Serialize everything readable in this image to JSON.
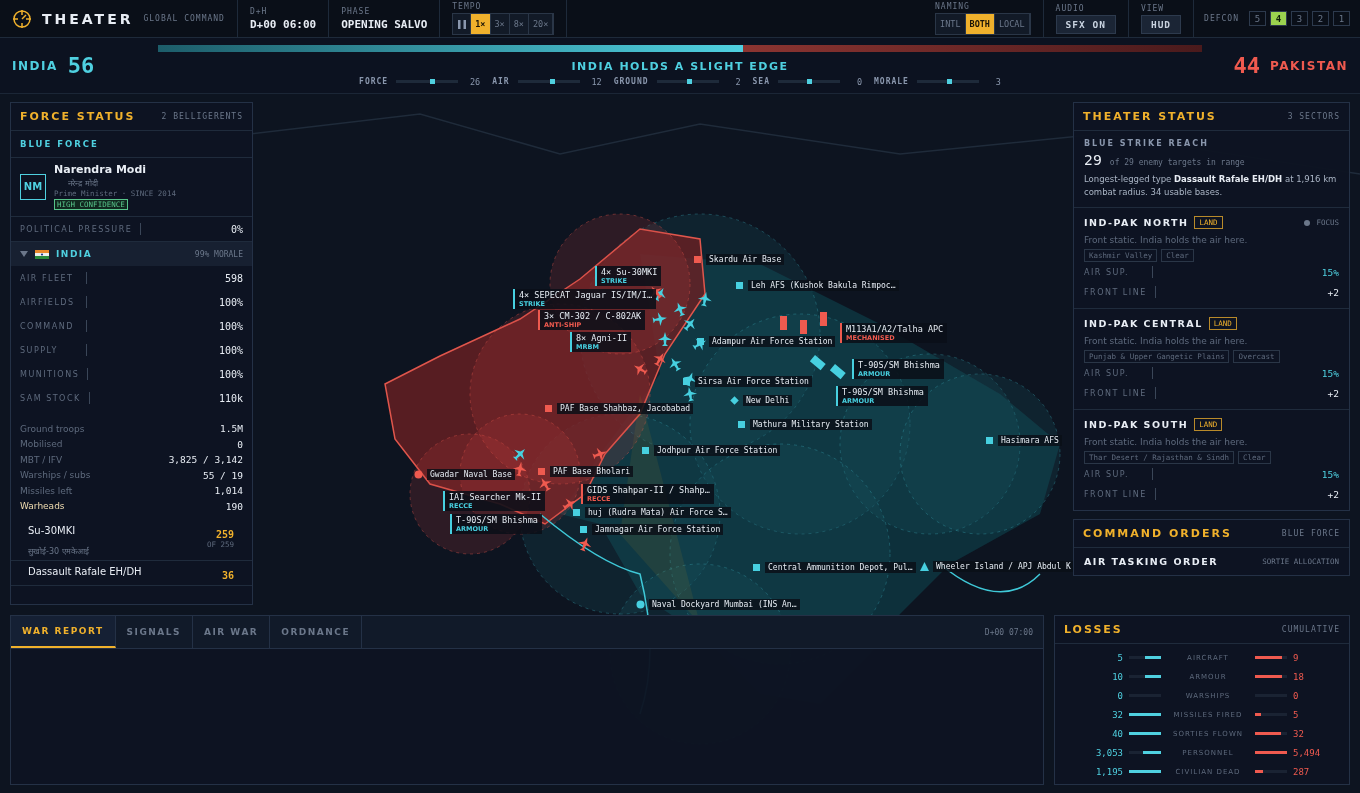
{
  "header": {
    "title": "THEATER",
    "subtitle": "GLOBAL COMMAND",
    "clock": {
      "label": "D+H",
      "value": "D+00 06:00"
    },
    "phase": {
      "label": "PHASE",
      "value": "OPENING SALVO"
    },
    "tempo": {
      "label": "TEMPO",
      "paused": false,
      "speeds": [
        {
          "label": "1×",
          "selected": true
        },
        {
          "label": "3×",
          "selected": false
        },
        {
          "label": "8×",
          "selected": false
        },
        {
          "label": "20×",
          "selected": false
        }
      ]
    },
    "naming": {
      "label": "NAMING",
      "options": [
        {
          "label": "INTL",
          "selected": false
        },
        {
          "label": "BOTH",
          "selected": true
        },
        {
          "label": "LOCAL",
          "selected": false
        }
      ]
    },
    "audio": {
      "label": "AUDIO",
      "button": "SFX ON"
    },
    "view": {
      "label": "VIEW",
      "button": "HUD"
    },
    "defcon": {
      "label": "DEFCON",
      "levels": [
        {
          "label": "5",
          "selected": false
        },
        {
          "label": "4",
          "selected": true
        },
        {
          "label": "3",
          "selected": false
        },
        {
          "label": "2",
          "selected": false
        },
        {
          "label": "1",
          "selected": false
        }
      ]
    }
  },
  "scoreboard": {
    "blue": {
      "name": "INDIA",
      "score": "56"
    },
    "red": {
      "name": "PAKISTAN",
      "score": "44"
    },
    "balance": {
      "level": 0.56
    },
    "headline": "INDIA HOLDS A SLIGHT EDGE",
    "metrics": [
      {
        "label": "FORCE",
        "level": 0.58,
        "value": "26"
      },
      {
        "label": "AIR",
        "level": 0.56,
        "value": "12"
      },
      {
        "label": "GROUND",
        "level": 0.52,
        "value": "2"
      },
      {
        "label": "SEA",
        "level": 0.5,
        "value": "0"
      },
      {
        "label": "MORALE",
        "level": 0.52,
        "value": "3"
      }
    ]
  },
  "map": {
    "places": [
      {
        "name": "Skardu Air Base",
        "color": "#ef5a4f",
        "kind": "base"
      },
      {
        "name": "Leh AFS (Kushok Bakula Rimpoc…",
        "color": "#47d0e0",
        "kind": "base"
      },
      {
        "name": "Adampur Air Force Station",
        "color": "#47d0e0",
        "kind": "base"
      },
      {
        "name": "Sirsa Air Force Station",
        "color": "#47d0e0",
        "kind": "base"
      },
      {
        "name": "New Delhi",
        "color": "#47d0e0",
        "kind": "city"
      },
      {
        "name": "Mathura Military Station",
        "color": "#47d0e0",
        "kind": "base"
      },
      {
        "name": "Jodhpur Air Force Station",
        "color": "#47d0e0",
        "kind": "base"
      },
      {
        "name": "PAF Base Shahbaz, Jacobabad",
        "color": "#ef5a4f",
        "kind": "base"
      },
      {
        "name": "Gwadar Naval Base",
        "color": "#ef5a4f",
        "kind": "port"
      },
      {
        "name": "PAF Base Bholari",
        "color": "#ef5a4f",
        "kind": "base"
      },
      {
        "name": "huj (Rudra Mata) Air Force S…",
        "color": "#47d0e0",
        "kind": "base"
      },
      {
        "name": "Jamnagar Air Force Station",
        "color": "#47d0e0",
        "kind": "base"
      },
      {
        "name": "Central Ammunition Depot, Pul…",
        "color": "#47d0e0",
        "kind": "base"
      },
      {
        "name": "Wheeler Island / APJ Abdul K",
        "color": "#47d0e0",
        "kind": "launch"
      },
      {
        "name": "Naval Dockyard Mumbai (INS An…",
        "color": "#47d0e0",
        "kind": "port"
      },
      {
        "name": "Hasimara AFS",
        "color": "#47d0e0",
        "kind": "base"
      }
    ],
    "units": [
      {
        "name": "4× Su-30MKI",
        "role": "STRIKE",
        "color": "#47d0e0"
      },
      {
        "name": "4× SEPECAT Jaguar IS/IM/I…",
        "role": "STRIKE",
        "color": "#47d0e0"
      },
      {
        "name": "3× CM-302 / C-802AK",
        "role": "ANTI-SHIP",
        "color": "#ef5a4f"
      },
      {
        "name": "8× Agni-II",
        "role": "MRBM",
        "color": "#47d0e0"
      },
      {
        "name": "M113A1/A2/Talha APC",
        "role": "MECHANISED",
        "color": "#ef5a4f"
      },
      {
        "name": "T-90S/SM Bhishma",
        "role": "ARMOUR",
        "color": "#47d0e0"
      },
      {
        "name": "T-90S/SM Bhishma",
        "role": "ARMOUR",
        "color": "#47d0e0"
      },
      {
        "name": "IAI Searcher Mk-II",
        "role": "RECCE",
        "color": "#47d0e0"
      },
      {
        "name": "GIDS Shahpar-II / Shahp…",
        "role": "RECCE",
        "color": "#ef5a4f"
      },
      {
        "name": "T-90S/SM Bhishma",
        "role": "ARMOUR",
        "color": "#47d0e0"
      }
    ]
  },
  "force_status": {
    "title": "FORCE STATUS",
    "count": "2 BELLIGERENTS",
    "side": "BLUE FORCE",
    "leader": {
      "initials": "NM",
      "name": "Narendra Modi",
      "native_name": "नरेन्द्र मोदी",
      "role": "Prime Minister · SINCE 2014",
      "confidence": "HIGH CONFIDENCE"
    },
    "pressure": {
      "label": "POLITICAL PRESSURE",
      "value": "0%"
    },
    "nation": {
      "name": "INDIA",
      "morale": "99% MORALE",
      "expanded": true
    },
    "stats": [
      {
        "label": "AIR FLEET",
        "value": "598"
      },
      {
        "label": "AIRFIELDS",
        "value": "100%"
      },
      {
        "label": "COMMAND",
        "value": "100%"
      },
      {
        "label": "SUPPLY",
        "value": "100%"
      },
      {
        "label": "MUNITIONS",
        "value": "100%"
      },
      {
        "label": "SAM STOCK",
        "value": "110k"
      }
    ],
    "details": [
      {
        "label": "Ground troops",
        "value": "1.5M",
        "highlight": false
      },
      {
        "label": "Mobilised",
        "value": "0",
        "highlight": false
      },
      {
        "label": "MBT / IFV",
        "value": "3,825 / 3,142",
        "highlight": false
      },
      {
        "label": "Warships / subs",
        "value": "55 / 19",
        "highlight": false
      },
      {
        "label": "Missiles left",
        "value": "1,014",
        "highlight": false
      },
      {
        "label": "Warheads",
        "value": "190",
        "highlight": true
      }
    ],
    "aircraft": [
      {
        "name": "Su-30MKI",
        "count": "259",
        "total": "OF 259",
        "native_name": "सुखोई-30 एमकेआई"
      },
      {
        "name": "Dassault Rafale EH/DH",
        "count": "36"
      }
    ]
  },
  "theater_status": {
    "title": "THEATER STATUS",
    "count": "3 SECTORS",
    "reach": {
      "label": "BLUE STRIKE REACH",
      "value": "29",
      "caption": "of 29 enemy targets in range",
      "text": "Longest-legged type **Dassault Rafale EH/DH** at 1,916 km combat radius. 34 usable bases."
    },
    "sectors": [
      {
        "name": "IND-PAK NORTH",
        "tag": "LAND",
        "focus": "FOCUS",
        "summary": "Front static. India holds the air here.",
        "terrain": "Kashmir Valley",
        "weather": "Clear",
        "rows": [
          {
            "label": "AIR SUP.",
            "value": "15%",
            "kind": "air"
          },
          {
            "label": "FRONT LINE",
            "value": "+2",
            "kind": "front"
          }
        ]
      },
      {
        "name": "IND-PAK CENTRAL",
        "tag": "LAND",
        "summary": "Front static. India holds the air here.",
        "terrain": "Punjab & Upper Gangetic Plains",
        "weather": "Overcast",
        "rows": [
          {
            "label": "AIR SUP.",
            "value": "15%",
            "kind": "air"
          },
          {
            "label": "FRONT LINE",
            "value": "+2",
            "kind": "front"
          }
        ]
      },
      {
        "name": "IND-PAK SOUTH",
        "tag": "LAND",
        "summary": "Front static. India holds the air here.",
        "terrain": "Thar Desert / Rajasthan & Sindh",
        "weather": "Clear",
        "rows": [
          {
            "label": "AIR SUP.",
            "value": "15%",
            "kind": "air"
          },
          {
            "label": "FRONT LINE",
            "value": "+2",
            "kind": "front"
          }
        ]
      }
    ]
  },
  "command_orders": {
    "title": "COMMAND ORDERS",
    "side": "BLUE FORCE",
    "order": {
      "title": "AIR TASKING ORDER",
      "note": "SORTIE ALLOCATION"
    }
  },
  "report": {
    "tabs": [
      {
        "label": "WAR REPORT",
        "selected": true
      },
      {
        "label": "SIGNALS",
        "selected": false
      },
      {
        "label": "AIR WAR",
        "selected": false
      },
      {
        "label": "ORDNANCE",
        "selected": false
      }
    ],
    "time": "D+00 07:00"
  },
  "losses": {
    "title": "LOSSES",
    "subtitle": "CUMULATIVE",
    "rows": [
      {
        "label": "AIRCRAFT",
        "blue": {
          "value": "5",
          "level": 0.5
        },
        "red": {
          "value": "9",
          "level": 0.85
        }
      },
      {
        "label": "ARMOUR",
        "blue": {
          "value": "10",
          "level": 0.5
        },
        "red": {
          "value": "18",
          "level": 0.85
        }
      },
      {
        "label": "WARSHIPS",
        "blue": {
          "value": "0",
          "level": 0
        },
        "red": {
          "value": "0",
          "level": 0
        }
      },
      {
        "label": "MISSILES FIRED",
        "blue": {
          "value": "32",
          "level": 1
        },
        "red": {
          "value": "5",
          "level": 0.2
        }
      },
      {
        "label": "SORTIES FLOWN",
        "blue": {
          "value": "40",
          "level": 1
        },
        "red": {
          "value": "32",
          "level": 0.8
        }
      },
      {
        "label": "PERSONNEL",
        "blue": {
          "value": "3,053",
          "level": 0.55
        },
        "red": {
          "value": "5,494",
          "level": 1
        }
      },
      {
        "label": "CIVILIAN DEAD",
        "blue": {
          "value": "1,195",
          "level": 1
        },
        "red": {
          "value": "287",
          "level": 0.25
        }
      }
    ]
  }
}
